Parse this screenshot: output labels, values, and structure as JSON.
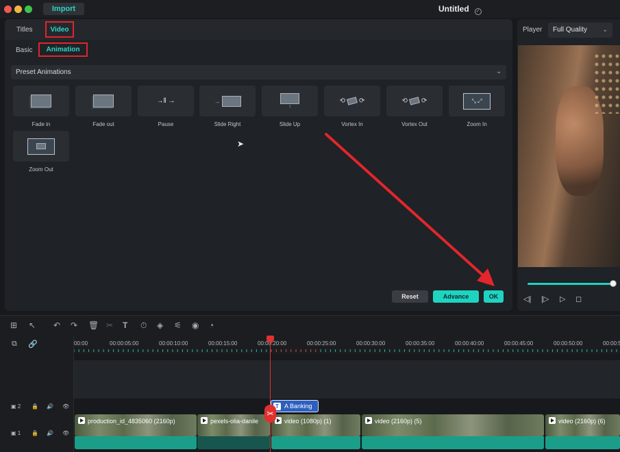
{
  "app": {
    "import_label": "Import",
    "project_title": "Untitled",
    "traffic": [
      "#ee5a52",
      "#f2b640",
      "#3bc64a"
    ]
  },
  "panel": {
    "tabs": [
      "Titles",
      "Video"
    ],
    "subtabs": [
      "Basic",
      "Animation"
    ],
    "preset_label": "Preset Animations",
    "presets": [
      "Fade in",
      "Fade out",
      "Pause",
      "Slide Right",
      "Slide Up",
      "Vortex In",
      "Vortex Out",
      "Zoom In",
      "Zoom Out"
    ],
    "buttons": {
      "reset": "Reset",
      "advance": "Advance",
      "ok": "OK"
    }
  },
  "player": {
    "label": "Player",
    "quality": "Full Quality",
    "progress": 0.98
  },
  "timeline": {
    "ticks": [
      "00:00",
      "00:00:05:00",
      "00:00:10:00",
      "00:00:15:00",
      "00:00:20:00",
      "00:00:25:00",
      "00:00:30:00",
      "00:00:35:00",
      "00:00:40:00",
      "00:00:45:00",
      "00:00:50:00",
      "00:00:5"
    ],
    "track2": "2",
    "track1": "1",
    "title_clip": "A Banking",
    "clips": [
      "production_id_4835060 (2160p)",
      "pexels-olia-danile",
      "video (1080p) (1)",
      "video (2160p) (5)",
      "video (2160p) (6)"
    ]
  },
  "colors": {
    "accent": "#1fd3c1",
    "highlight": "#e0252c"
  }
}
